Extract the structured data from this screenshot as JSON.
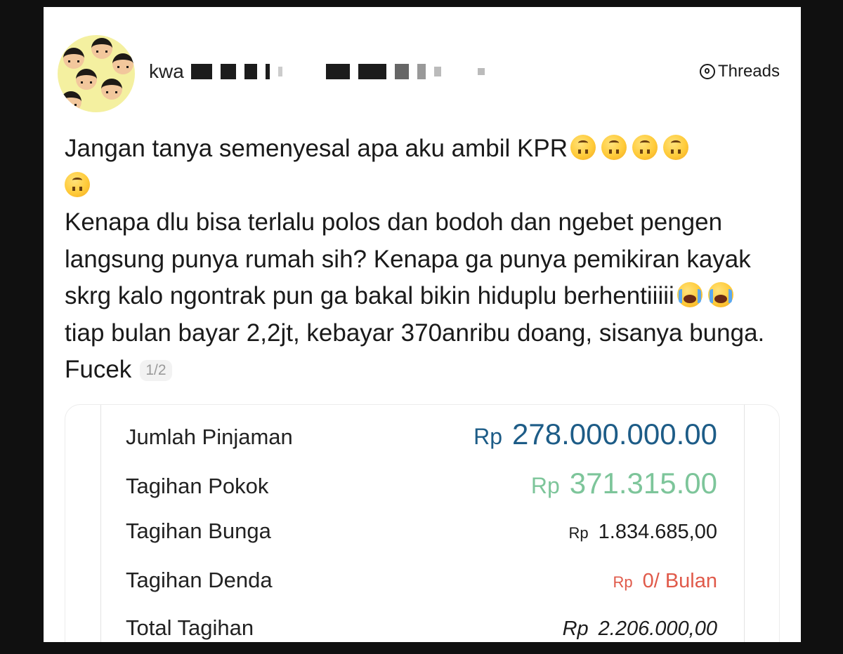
{
  "header": {
    "username_visible": "kwa",
    "app_name": "Threads"
  },
  "post": {
    "line1": "Jangan tanya semenyesal apa aku ambil KPR",
    "line2": "Kenapa dlu bisa terlalu polos dan bodoh dan ngebet pengen langsung punya rumah sih? Kenapa ga punya pemikiran kayak skrg kalo ngontrak pun ga bakal bikin hiduplu berhentiiiii",
    "line3": " tiap bulan bayar 2,2jt, kebayar 370anribu doang, sisanya bunga. Fucek",
    "page_indicator": "1/2",
    "emojis": [
      "upside-down-face-icon",
      "loudly-crying-face-icon"
    ]
  },
  "loan_screenshot": {
    "rows": [
      {
        "label": "Jumlah Pinjaman",
        "currency": "Rp",
        "value": "278.000.000.00"
      },
      {
        "label": "Tagihan Pokok",
        "currency": "Rp",
        "value": "371.315.00"
      },
      {
        "label": "Tagihan Bunga",
        "currency": "Rp",
        "value": "1.834.685,00"
      },
      {
        "label": "Tagihan Denda",
        "currency": "Rp",
        "value": "0/ Bulan"
      },
      {
        "label": "Total Tagihan",
        "currency": "Rp",
        "value": "2.206.000,00"
      }
    ]
  },
  "colors": {
    "loan_amount": "#1d5c87",
    "principal": "#7dc59a",
    "penalty": "#e05a4a"
  }
}
